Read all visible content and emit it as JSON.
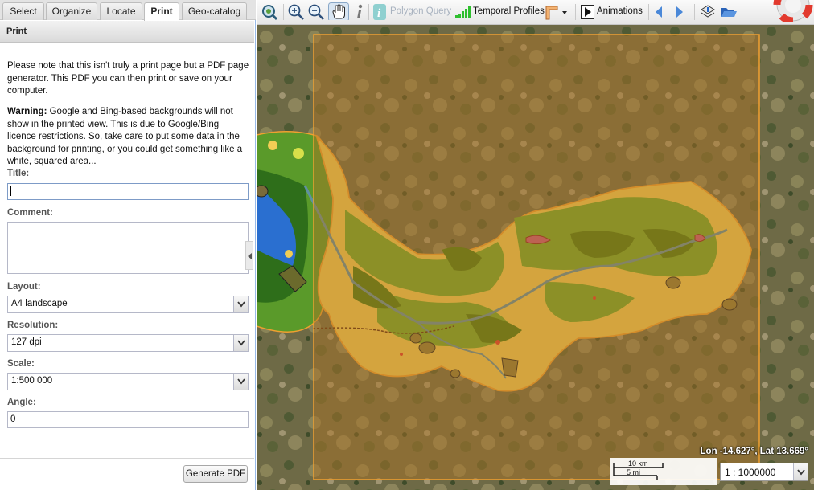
{
  "tabs": [
    {
      "label": "Select"
    },
    {
      "label": "Organize"
    },
    {
      "label": "Locate"
    },
    {
      "label": "Print"
    },
    {
      "label": "Geo-catalog"
    }
  ],
  "panel": {
    "title": "Print",
    "intro": "Please note that this isn't truly a print page but a PDF page generator. This PDF you can then print or save on your computer.",
    "warning_label": "Warning:",
    "warning_text": " Google and Bing-based backgrounds will not show in the printed view. This is due to Google/Bing licence restrictions. So, take care to put some data in the background for printing, or you could get something like a white, squared area..."
  },
  "form": {
    "title_label": "Title:",
    "title_value": "",
    "comment_label": "Comment:",
    "layout_label": "Layout:",
    "layout_value": "A4 landscape",
    "resolution_label": "Resolution:",
    "resolution_value": "127 dpi",
    "scale_label": "Scale:",
    "scale_value": "1:500 000",
    "angle_label": "Angle:",
    "angle_value": "0",
    "generate_label": "Generate PDF"
  },
  "toolbar": {
    "polygon_query": "Polygon Query",
    "temporal_profiles": "Temporal Profiles",
    "animations": "Animations"
  },
  "map": {
    "coordinates": "Lon -14.627°, Lat 13.669°",
    "scale_km": "10 km",
    "scale_mi": "5 mi",
    "scale_value": "1 : 1000000"
  },
  "colors": {
    "accent": "#99bbe8",
    "print_extent": "#f0a030",
    "landcover_yellow": "#f2cd55",
    "landcover_green": "#6fa82a",
    "landcover_darkgreen": "#4a7a12",
    "river": "#5f90a0"
  }
}
